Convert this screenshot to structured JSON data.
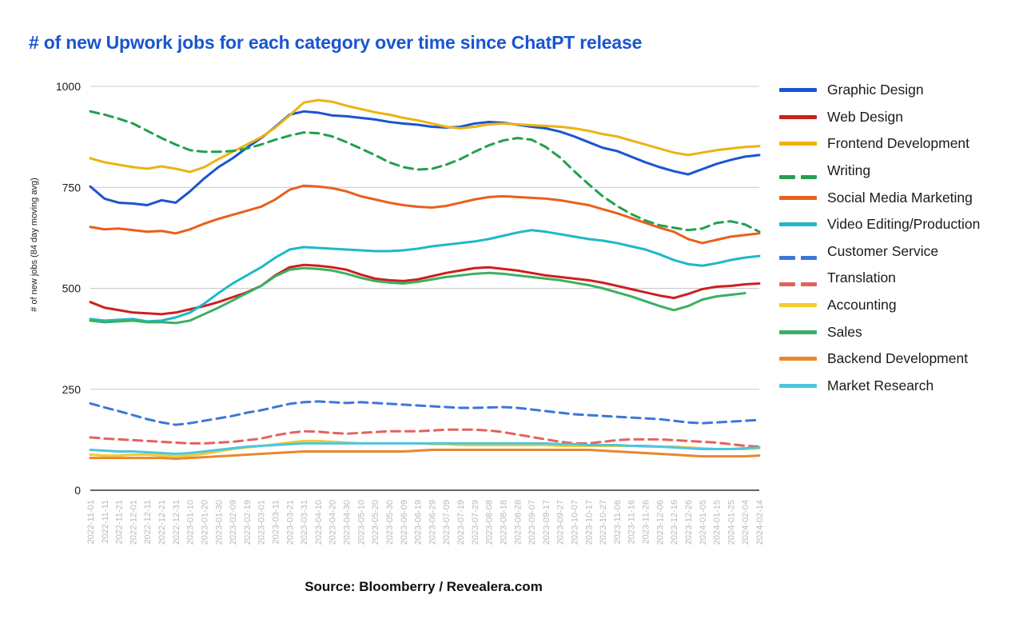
{
  "title": "# of new Upwork jobs for each category over time since ChatPT release",
  "source_note": "Source: Bloomberry / Revealera.com",
  "colors": {
    "title": "#1a55d0",
    "gridline": "#c8c8c8",
    "axis": "#333333",
    "xtick": "#b9b9b9"
  },
  "chart_data": {
    "type": "line",
    "title": "# of new Upwork jobs for each category over time since ChatPT release",
    "xlabel": "",
    "ylabel": "# of new jobs (84 day moving avg)",
    "ylim": [
      0,
      1000
    ],
    "yticks": [
      0,
      250,
      500,
      750,
      1000
    ],
    "grid": true,
    "legend_position": "right",
    "x": [
      "2022-11-01",
      "2022-11-11",
      "2022-11-21",
      "2022-12-01",
      "2022-12-11",
      "2022-12-21",
      "2022-12-31",
      "2023-01-10",
      "2023-01-20",
      "2023-01-30",
      "2023-02-09",
      "2023-02-19",
      "2023-03-01",
      "2023-03-11",
      "2023-03-21",
      "2023-03-31",
      "2023-04-10",
      "2023-04-20",
      "2023-04-30",
      "2023-05-10",
      "2023-05-20",
      "2023-05-30",
      "2023-06-09",
      "2023-06-19",
      "2023-06-29",
      "2023-07-09",
      "2023-07-19",
      "2023-07-29",
      "2023-08-08",
      "2023-08-18",
      "2023-08-28",
      "2023-09-07",
      "2023-09-17",
      "2023-09-27",
      "2023-10-07",
      "2023-10-17",
      "2023-10-27",
      "2023-11-06",
      "2023-11-16",
      "2023-11-26",
      "2023-12-06",
      "2023-12-16",
      "2023-12-26",
      "2024-01-05",
      "2024-01-15",
      "2024-01-25",
      "2024-02-04",
      "2024-02-14"
    ],
    "series": [
      {
        "name": "Graphic Design",
        "color": "#1a55d0",
        "style": "solid",
        "values": [
          752,
          722,
          712,
          710,
          706,
          718,
          712,
          740,
          772,
          800,
          822,
          848,
          872,
          900,
          930,
          938,
          935,
          928,
          926,
          922,
          918,
          912,
          908,
          905,
          900,
          898,
          900,
          908,
          912,
          910,
          905,
          900,
          896,
          888,
          876,
          862,
          848,
          840,
          826,
          812,
          800,
          790,
          782,
          795,
          808,
          818,
          826,
          830
        ]
      },
      {
        "name": "Web Design",
        "color": "#cc2020",
        "style": "solid",
        "values": [
          466,
          452,
          446,
          440,
          438,
          436,
          440,
          448,
          456,
          466,
          478,
          490,
          506,
          532,
          552,
          558,
          556,
          552,
          546,
          534,
          524,
          520,
          518,
          522,
          530,
          538,
          544,
          550,
          552,
          548,
          544,
          538,
          532,
          528,
          524,
          520,
          514,
          506,
          498,
          490,
          482,
          476,
          486,
          498,
          504,
          506,
          510,
          512
        ]
      },
      {
        "name": "Frontend Development",
        "color": "#edb212",
        "style": "solid",
        "values": [
          822,
          812,
          806,
          800,
          796,
          802,
          796,
          788,
          800,
          820,
          838,
          856,
          874,
          898,
          928,
          960,
          966,
          962,
          952,
          944,
          936,
          930,
          922,
          916,
          908,
          900,
          896,
          900,
          906,
          908,
          906,
          904,
          902,
          900,
          896,
          890,
          882,
          876,
          866,
          856,
          846,
          836,
          830,
          836,
          842,
          846,
          850,
          852
        ]
      },
      {
        "name": "Writing",
        "color": "#22a04e",
        "style": "dashed",
        "values": [
          938,
          930,
          920,
          908,
          890,
          872,
          856,
          842,
          838,
          838,
          840,
          846,
          856,
          868,
          878,
          886,
          884,
          876,
          862,
          846,
          830,
          812,
          800,
          794,
          796,
          806,
          820,
          838,
          854,
          866,
          872,
          868,
          850,
          824,
          790,
          758,
          728,
          704,
          684,
          668,
          656,
          650,
          644,
          648,
          662,
          666,
          658,
          640
        ]
      },
      {
        "name": "Social Media Marketing",
        "color": "#e8601c",
        "style": "solid",
        "values": [
          652,
          646,
          648,
          644,
          640,
          642,
          636,
          646,
          660,
          672,
          682,
          692,
          702,
          720,
          744,
          754,
          752,
          748,
          740,
          728,
          720,
          712,
          706,
          702,
          700,
          704,
          712,
          720,
          726,
          728,
          726,
          724,
          722,
          718,
          712,
          706,
          696,
          686,
          674,
          662,
          650,
          640,
          622,
          612,
          620,
          628,
          632,
          636
        ]
      },
      {
        "name": "Video Editing/Production",
        "color": "#1eb8c8",
        "style": "solid",
        "values": [
          424,
          420,
          422,
          424,
          418,
          420,
          428,
          440,
          462,
          488,
          512,
          532,
          552,
          576,
          596,
          602,
          600,
          598,
          596,
          594,
          592,
          592,
          594,
          598,
          604,
          608,
          612,
          616,
          622,
          630,
          638,
          644,
          640,
          634,
          628,
          622,
          618,
          612,
          604,
          596,
          584,
          570,
          560,
          556,
          562,
          570,
          576,
          580
        ]
      },
      {
        "name": "Customer Service",
        "color": "#3a78d8",
        "style": "dashed",
        "values": [
          215,
          205,
          196,
          186,
          176,
          168,
          162,
          166,
          172,
          178,
          184,
          192,
          198,
          206,
          214,
          218,
          220,
          218,
          216,
          218,
          216,
          214,
          212,
          210,
          208,
          206,
          204,
          204,
          205,
          206,
          204,
          200,
          196,
          192,
          188,
          186,
          184,
          182,
          180,
          178,
          176,
          172,
          168,
          166,
          168,
          170,
          172,
          174
        ]
      },
      {
        "name": "Translation",
        "color": "#e5615c",
        "style": "dashed",
        "values": [
          131,
          128,
          126,
          124,
          122,
          120,
          118,
          116,
          116,
          118,
          120,
          124,
          128,
          136,
          142,
          146,
          145,
          142,
          140,
          142,
          144,
          146,
          146,
          146,
          148,
          150,
          150,
          150,
          148,
          144,
          138,
          132,
          126,
          120,
          116,
          116,
          120,
          124,
          126,
          126,
          126,
          124,
          122,
          120,
          118,
          114,
          110,
          108
        ]
      },
      {
        "name": "Accounting",
        "color": "#f2cb30",
        "style": "solid",
        "values": [
          88,
          86,
          86,
          88,
          88,
          86,
          84,
          86,
          90,
          96,
          102,
          106,
          110,
          114,
          118,
          122,
          122,
          120,
          118,
          116,
          116,
          116,
          116,
          116,
          114,
          114,
          112,
          112,
          112,
          112,
          112,
          112,
          112,
          110,
          110,
          110,
          110,
          110,
          110,
          108,
          108,
          108,
          106,
          104,
          102,
          102,
          102,
          104
        ]
      },
      {
        "name": "Sales",
        "color": "#3bb062",
        "style": "solid",
        "values": [
          420,
          416,
          418,
          420,
          416,
          416,
          414,
          420,
          436,
          452,
          470,
          488,
          506,
          530,
          546,
          550,
          548,
          544,
          536,
          526,
          518,
          514,
          512,
          516,
          522,
          528,
          532,
          536,
          538,
          536,
          532,
          528,
          524,
          520,
          514,
          508,
          500,
          490,
          480,
          468,
          456,
          446,
          456,
          472,
          480,
          484,
          488
        ]
      },
      {
        "name": "Backend Development",
        "color": "#e8882e",
        "style": "solid",
        "values": [
          80,
          80,
          80,
          80,
          80,
          80,
          78,
          80,
          82,
          84,
          86,
          88,
          90,
          92,
          94,
          96,
          96,
          96,
          96,
          96,
          96,
          96,
          96,
          98,
          100,
          100,
          100,
          100,
          100,
          100,
          100,
          100,
          100,
          100,
          100,
          100,
          98,
          96,
          94,
          92,
          90,
          88,
          86,
          84,
          84,
          84,
          84,
          86
        ]
      },
      {
        "name": "Market Research",
        "color": "#4cc6dd",
        "style": "solid",
        "values": [
          100,
          98,
          96,
          96,
          94,
          92,
          90,
          92,
          96,
          100,
          104,
          108,
          110,
          112,
          114,
          116,
          116,
          116,
          116,
          116,
          116,
          116,
          116,
          116,
          116,
          116,
          116,
          116,
          116,
          116,
          116,
          116,
          116,
          114,
          114,
          112,
          112,
          112,
          110,
          110,
          108,
          106,
          104,
          102,
          102,
          102,
          104,
          106
        ]
      }
    ]
  }
}
